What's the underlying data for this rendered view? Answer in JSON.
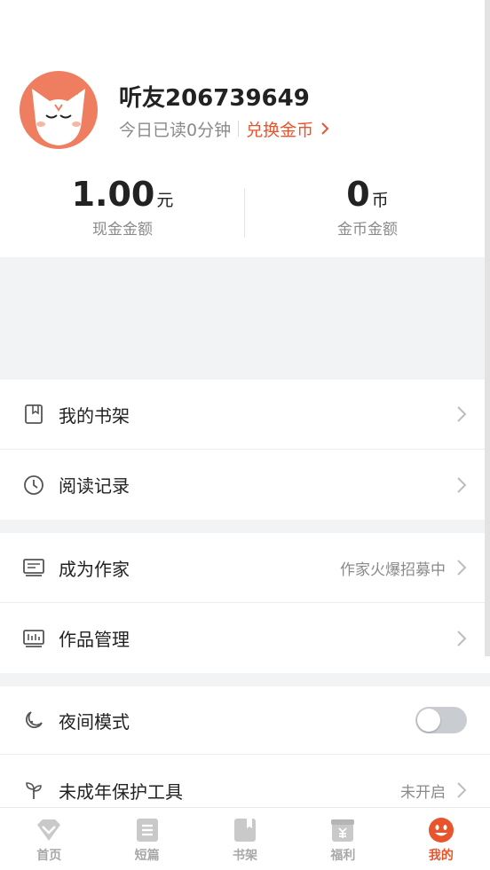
{
  "profile": {
    "username": "听友206739649",
    "read_today": "今日已读0分钟",
    "exchange_label": "兑换金币"
  },
  "stats": {
    "cash_value": "1.00",
    "cash_unit": "元",
    "cash_label": "现金金额",
    "coin_value": "0",
    "coin_unit": "币",
    "coin_label": "金币金额"
  },
  "menu_group1": [
    {
      "label": "我的书架",
      "icon": "bookshelf-icon"
    },
    {
      "label": "阅读记录",
      "icon": "clock-icon"
    }
  ],
  "menu_group2": [
    {
      "label": "成为作家",
      "icon": "author-icon",
      "right_text": "作家火爆招募中"
    },
    {
      "label": "作品管理",
      "icon": "works-manage-icon"
    }
  ],
  "menu_group3": [
    {
      "label": "夜间模式",
      "icon": "moon-icon",
      "toggle": false
    },
    {
      "label": "未成年保护工具",
      "icon": "sprout-icon",
      "right_text": "未开启"
    }
  ],
  "bottom_nav": [
    {
      "label": "首页",
      "icon": "home-icon",
      "active": false
    },
    {
      "label": "短篇",
      "icon": "short-story-icon",
      "active": false
    },
    {
      "label": "书架",
      "icon": "bookshelf-nav-icon",
      "active": false
    },
    {
      "label": "福利",
      "icon": "welfare-icon",
      "active": false
    },
    {
      "label": "我的",
      "icon": "mine-icon",
      "active": true
    }
  ],
  "colors": {
    "accent": "#e8542c",
    "avatar_bg": "#ef7d5f",
    "background": "#f2f3f5"
  }
}
